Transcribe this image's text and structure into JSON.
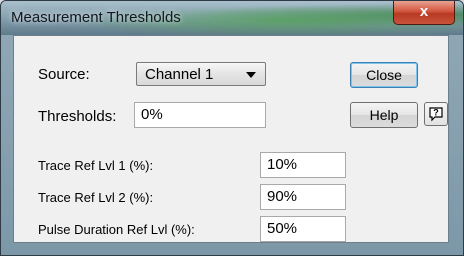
{
  "window": {
    "title": "Measurement Thresholds",
    "close_glyph": "x"
  },
  "source": {
    "label": "Source:",
    "value": "Channel 1"
  },
  "thresholds": {
    "label": "Thresholds:",
    "value": "0%"
  },
  "buttons": {
    "close": "Close",
    "help": "Help",
    "context_help_icon": "context-help-icon"
  },
  "ref_levels": [
    {
      "label": "Trace Ref Lvl 1 (%):",
      "value": "10%"
    },
    {
      "label": "Trace Ref Lvl 2 (%):",
      "value": "90%"
    },
    {
      "label": "Pulse Duration Ref Lvl (%):",
      "value": "50%"
    }
  ]
}
